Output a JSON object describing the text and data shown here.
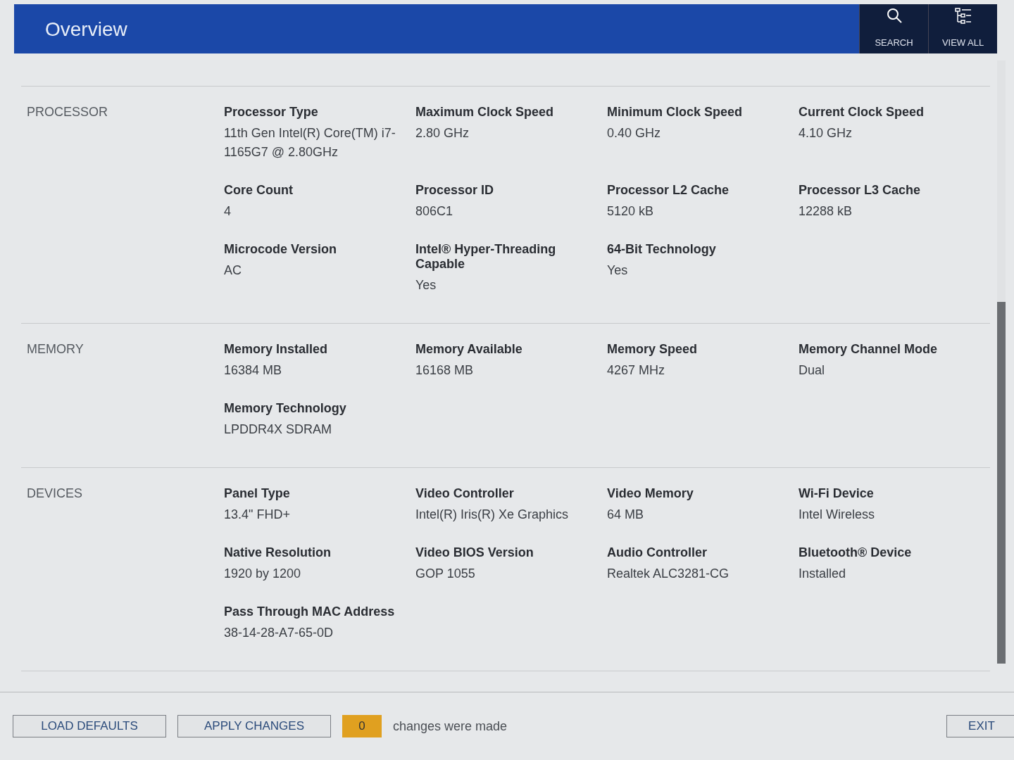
{
  "header": {
    "title": "Overview",
    "actions": [
      {
        "kind": "search",
        "label": "SEARCH"
      },
      {
        "kind": "view_all",
        "label": "VIEW ALL"
      }
    ]
  },
  "sections": [
    {
      "title": "PROCESSOR",
      "fields": [
        {
          "label": "Processor Type",
          "value": "11th Gen Intel(R) Core(TM) i7-1165G7 @ 2.80GHz"
        },
        {
          "label": "Maximum Clock Speed",
          "value": "2.80 GHz"
        },
        {
          "label": "Minimum Clock Speed",
          "value": "0.40 GHz"
        },
        {
          "label": "Current Clock Speed",
          "value": "4.10 GHz"
        },
        {
          "label": "Core Count",
          "value": "4"
        },
        {
          "label": "Processor ID",
          "value": "806C1"
        },
        {
          "label": "Processor L2 Cache",
          "value": "5120 kB"
        },
        {
          "label": "Processor L3 Cache",
          "value": "12288 kB"
        },
        {
          "label": "Microcode Version",
          "value": "AC"
        },
        {
          "label": "Intel® Hyper-Threading Capable",
          "value": "Yes"
        },
        {
          "label": "64-Bit Technology",
          "value": "Yes"
        }
      ]
    },
    {
      "title": "MEMORY",
      "fields": [
        {
          "label": "Memory Installed",
          "value": "16384 MB"
        },
        {
          "label": "Memory Available",
          "value": "16168 MB"
        },
        {
          "label": "Memory Speed",
          "value": "4267 MHz"
        },
        {
          "label": "Memory Channel Mode",
          "value": "Dual"
        },
        {
          "label": "Memory Technology",
          "value": "LPDDR4X SDRAM"
        }
      ]
    },
    {
      "title": "DEVICES",
      "fields": [
        {
          "label": "Panel Type",
          "value": "13.4\" FHD+"
        },
        {
          "label": "Video Controller",
          "value": "Intel(R) Iris(R) Xe Graphics"
        },
        {
          "label": "Video Memory",
          "value": "64 MB"
        },
        {
          "label": "Wi-Fi Device",
          "value": "Intel Wireless"
        },
        {
          "label": "Native Resolution",
          "value": "1920 by 1200"
        },
        {
          "label": "Video BIOS Version",
          "value": "GOP 1055"
        },
        {
          "label": "Audio Controller",
          "value": "Realtek ALC3281-CG"
        },
        {
          "label": "Bluetooth® Device",
          "value": "Installed"
        },
        {
          "label": "Pass Through MAC Address",
          "value": "38-14-28-A7-65-0D"
        }
      ]
    }
  ],
  "footer": {
    "buttons": [
      "LOAD DEFAULTS",
      "APPLY CHANGES"
    ],
    "changes_count": "0",
    "changes_text": "changes were made",
    "exit": "EXIT"
  }
}
